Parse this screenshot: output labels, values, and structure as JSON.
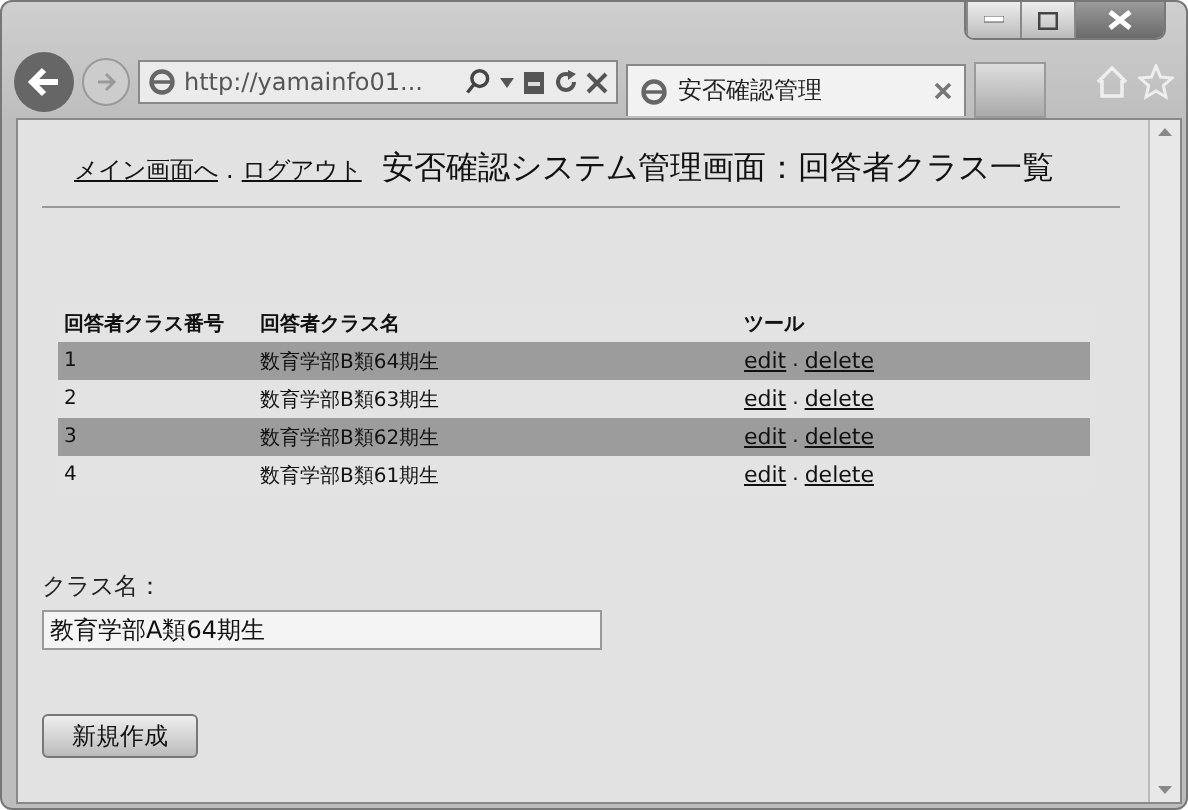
{
  "browser": {
    "address": "http://yamainfo01...",
    "tab": {
      "title": "安否確認管理",
      "selected": true
    }
  },
  "header": {
    "links": [
      "メイン画面へ",
      "ログアウト"
    ],
    "separator": ".",
    "title": "安否確認システム管理画面：回答者クラス一覧"
  },
  "table": {
    "columns": [
      "回答者クラス番号",
      "回答者クラス名",
      "ツール"
    ],
    "rows": [
      {
        "number": "1",
        "name": "数育学部B類64期生",
        "edit": "edit",
        "separator": ".",
        "delete": "delete",
        "shaded": true
      },
      {
        "number": "2",
        "name": "数育学部B類63期生",
        "edit": "edit",
        "separator": ".",
        "delete": "delete",
        "shaded": false
      },
      {
        "number": "3",
        "name": "数育学部B類62期生",
        "edit": "edit",
        "separator": ".",
        "delete": "delete",
        "shaded": true
      },
      {
        "number": "4",
        "name": "数育学部B類61期生",
        "edit": "edit",
        "separator": ".",
        "delete": "delete",
        "shaded": false
      }
    ]
  },
  "form": {
    "label": "クラス名：",
    "value": "教育学部A類64期生",
    "button": "新規作成"
  }
}
